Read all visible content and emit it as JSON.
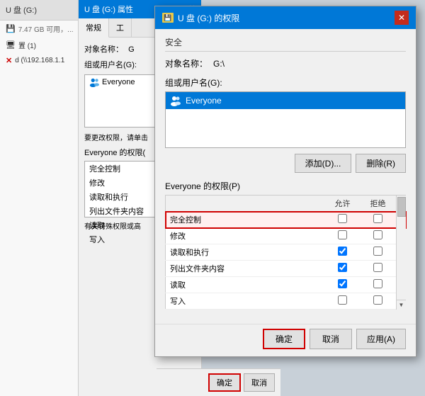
{
  "background": {
    "left_panel": {
      "title": "U 盘 (G:)",
      "items": [
        {
          "icon": "💾",
          "label": "7.47 GB 可用，..."
        },
        {
          "icon": "🖥",
          "label": "置 (1)"
        },
        {
          "icon": "📁",
          "label": "d (\\\\192.168.1.1"
        }
      ]
    },
    "mid_panel": {
      "title": "U 盘 (G:) 属性",
      "tabs": [
        "常规",
        "工"
      ],
      "active_tab": "常规",
      "object_label": "对象名称：",
      "object_value": "G",
      "group_label": "组或用户名(G):",
      "users": [
        "Everyone"
      ],
      "note": "要更改权限，请单击",
      "perm_header": "Everyone 的权限(",
      "permissions": [
        "完全控制",
        "修改",
        "读取和执行",
        "列出文件夹内容",
        "读取",
        "写入"
      ],
      "special_note": "有关特殊权限或高",
      "footer_buttons": [
        "确定",
        "取消"
      ]
    }
  },
  "dialog": {
    "title": "U 盘 (G:) 的权限",
    "title_icon": "💾",
    "close_btn": "✕",
    "section_security": "安全",
    "object_label": "对象名称：",
    "object_value": "G:\\",
    "group_label": "组或用户名(G):",
    "users": [
      {
        "name": "Everyone",
        "selected": true
      }
    ],
    "note_text": "",
    "add_btn": "添加(D)...",
    "remove_btn": "删除(R)",
    "perm_label": "Everyone 的权限(P)",
    "perm_col_allow": "允许",
    "perm_col_deny": "拒绝",
    "permissions": [
      {
        "name": "完全控制",
        "allow": false,
        "deny": false,
        "highlight": true
      },
      {
        "name": "修改",
        "allow": false,
        "deny": false,
        "highlight": false
      },
      {
        "name": "读取和执行",
        "allow": true,
        "deny": false,
        "highlight": false
      },
      {
        "name": "列出文件夹内容",
        "allow": true,
        "deny": false,
        "highlight": false
      },
      {
        "name": "读取",
        "allow": true,
        "deny": false,
        "highlight": false
      },
      {
        "name": "写入",
        "allow": false,
        "deny": false,
        "highlight": false
      }
    ],
    "footer": {
      "ok": "确定",
      "cancel": "取消",
      "apply": "应用(A)"
    }
  }
}
